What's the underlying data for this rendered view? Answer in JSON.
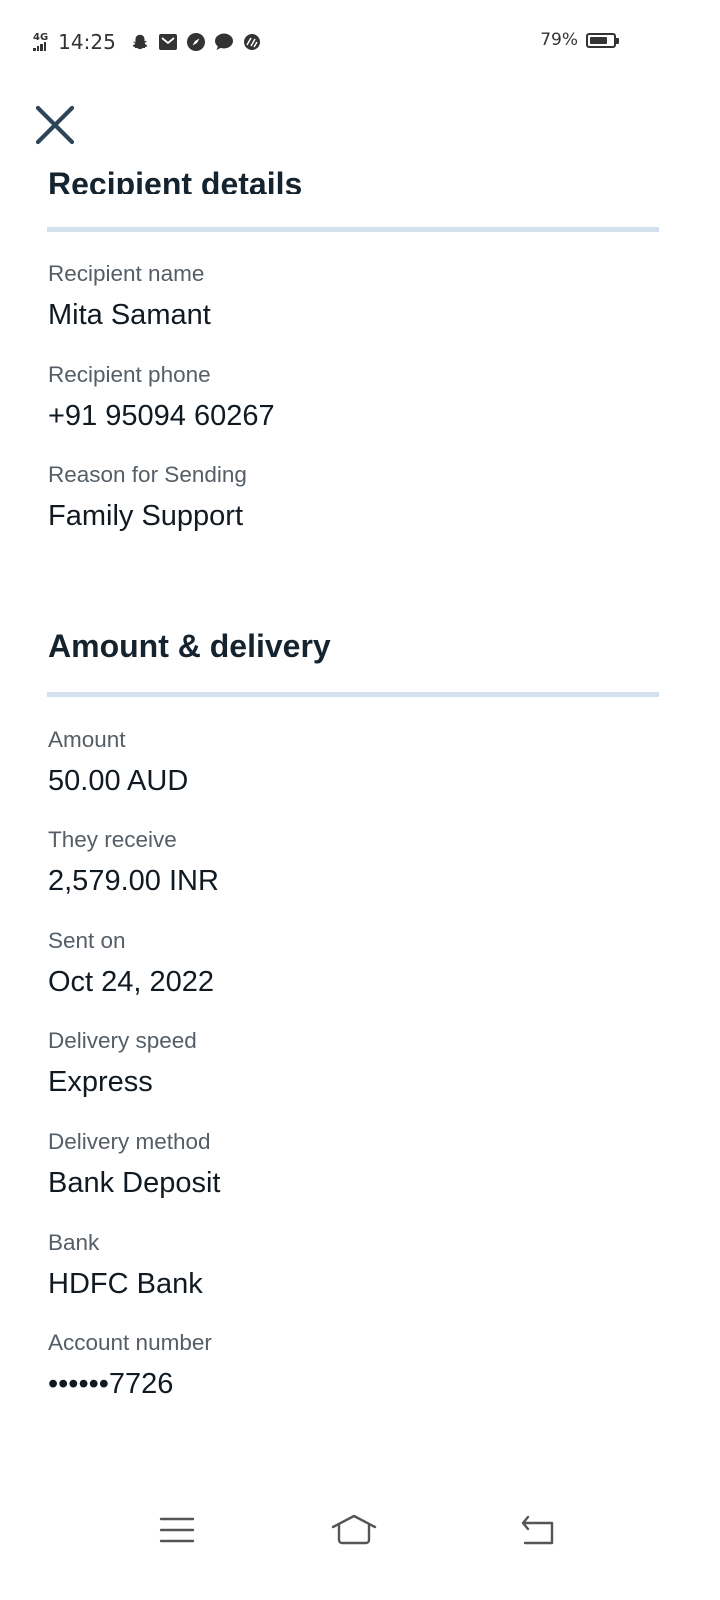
{
  "status_bar": {
    "network": "4G",
    "time": "14:25",
    "notification_icons": [
      "snapchat-icon",
      "mail-icon",
      "compass-icon",
      "message-icon",
      "app-icon"
    ],
    "battery_percent": "79%",
    "battery_level": 0.79
  },
  "header": {
    "close_icon": "close-icon"
  },
  "recipient_section": {
    "title": "Recipient details",
    "fields": [
      {
        "label": "Recipient name",
        "value": "Mita Samant"
      },
      {
        "label": "Recipient phone",
        "value": "+91 95094 60267"
      },
      {
        "label": "Reason for Sending",
        "value": "Family Support"
      }
    ]
  },
  "amount_section": {
    "title": "Amount & delivery",
    "fields": [
      {
        "label": "Amount",
        "value": "50.00 AUD"
      },
      {
        "label": "They receive",
        "value": "2,579.00 INR"
      },
      {
        "label": "Sent on",
        "value": "Oct 24, 2022"
      },
      {
        "label": "Delivery speed",
        "value": "Express"
      },
      {
        "label": "Delivery method",
        "value": "Bank Deposit"
      },
      {
        "label": "Bank",
        "value": "HDFC Bank"
      },
      {
        "label": "Account number",
        "value": "••••••7726"
      }
    ]
  },
  "nav_bar": {
    "icons": [
      "menu-icon",
      "home-icon",
      "back-icon"
    ]
  },
  "colors": {
    "divider": "#d5e0ee",
    "title": "#15232f",
    "label": "#555e66",
    "value": "#111a22",
    "close_icon": "#2e4458"
  }
}
